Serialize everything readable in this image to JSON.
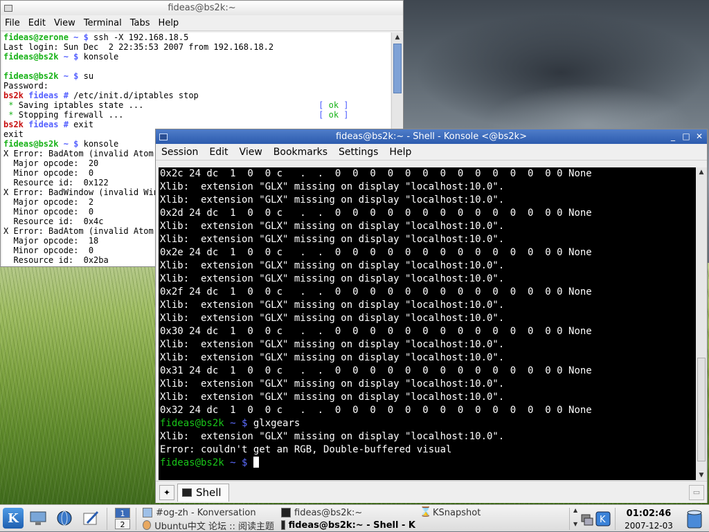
{
  "colors": {
    "active_titlebar": "#3a67b9",
    "terminal_bg": "#000000",
    "prompt_green": "#19c519",
    "prompt_blue": "#5c6cff",
    "root_red": "#c81010"
  },
  "back_window": {
    "title": "fideas@bs2k:~",
    "menu": [
      "File",
      "Edit",
      "View",
      "Terminal",
      "Tabs",
      "Help"
    ],
    "lines": [
      [
        {
          "t": "fideas@zerone",
          "c": "c-green"
        },
        {
          "t": " ~ $ ",
          "c": "c-blue"
        },
        {
          "t": "ssh -X 192.168.18.5"
        }
      ],
      [
        {
          "t": "Last login: Sun Dec  2 22:35:53 2007 from 192.168.18.2"
        }
      ],
      [
        {
          "t": "fideas@bs2k",
          "c": "c-green"
        },
        {
          "t": " ~ $ ",
          "c": "c-blue"
        },
        {
          "t": "konsole"
        }
      ],
      [
        {
          "t": ""
        }
      ],
      [
        {
          "t": "fideas@bs2k",
          "c": "c-green"
        },
        {
          "t": " ~ $ ",
          "c": "c-blue"
        },
        {
          "t": "su"
        }
      ],
      [
        {
          "t": "Password:"
        }
      ],
      [
        {
          "t": "bs2k ",
          "c": "c-red"
        },
        {
          "t": "fideas # ",
          "c": "c-blue"
        },
        {
          "t": "/etc/init.d/iptables stop"
        }
      ],
      [
        {
          "t": " * ",
          "c": "c-ok"
        },
        {
          "t": "Saving iptables state ...                                   "
        },
        {
          "t": "[ ",
          "c": "c-bracket"
        },
        {
          "t": "ok",
          "c": "c-ok"
        },
        {
          "t": " ]",
          "c": "c-bracket"
        }
      ],
      [
        {
          "t": " * ",
          "c": "c-ok"
        },
        {
          "t": "Stopping firewall ...                                       "
        },
        {
          "t": "[ ",
          "c": "c-bracket"
        },
        {
          "t": "ok",
          "c": "c-ok"
        },
        {
          "t": " ]",
          "c": "c-bracket"
        }
      ],
      [
        {
          "t": "bs2k ",
          "c": "c-red"
        },
        {
          "t": "fideas # ",
          "c": "c-blue"
        },
        {
          "t": "exit"
        }
      ],
      [
        {
          "t": "exit"
        }
      ],
      [
        {
          "t": "fideas@bs2k",
          "c": "c-green"
        },
        {
          "t": " ~ $ ",
          "c": "c-blue"
        },
        {
          "t": "konsole"
        }
      ],
      [
        {
          "t": "X Error: BadAtom (invalid Atom p"
        }
      ],
      [
        {
          "t": "  Major opcode:  20"
        }
      ],
      [
        {
          "t": "  Minor opcode:  0"
        }
      ],
      [
        {
          "t": "  Resource id:  0x122"
        }
      ],
      [
        {
          "t": "X Error: BadWindow (invalid Wind"
        }
      ],
      [
        {
          "t": "  Major opcode:  2"
        }
      ],
      [
        {
          "t": "  Minor opcode:  0"
        }
      ],
      [
        {
          "t": "  Resource id:  0x4c"
        }
      ],
      [
        {
          "t": "X Error: BadAtom (invalid Atom p"
        }
      ],
      [
        {
          "t": "  Major opcode:  18"
        }
      ],
      [
        {
          "t": "  Minor opcode:  0"
        }
      ],
      [
        {
          "t": "  Resource id:  0x2ba"
        }
      ]
    ]
  },
  "front_window": {
    "title": "fideas@bs2k:~ - Shell - Konsole <@bs2k>",
    "menu": [
      "Session",
      "Edit",
      "View",
      "Bookmarks",
      "Settings",
      "Help"
    ],
    "tab_label": "Shell",
    "lines": [
      [
        {
          "t": "0x2c 24 dc  1  0  0 c   .  .  0  0  0  0  0  0  0  0  0  0  0  0  0 0 None"
        }
      ],
      [
        {
          "t": "Xlib:  extension \"GLX\" missing on display \"localhost:10.0\"."
        }
      ],
      [
        {
          "t": "Xlib:  extension \"GLX\" missing on display \"localhost:10.0\"."
        }
      ],
      [
        {
          "t": "0x2d 24 dc  1  0  0 c   .  .  0  0  0  0  0  0  0  0  0  0  0  0  0 0 None"
        }
      ],
      [
        {
          "t": "Xlib:  extension \"GLX\" missing on display \"localhost:10.0\"."
        }
      ],
      [
        {
          "t": "Xlib:  extension \"GLX\" missing on display \"localhost:10.0\"."
        }
      ],
      [
        {
          "t": "0x2e 24 dc  1  0  0 c   .  .  0  0  0  0  0  0  0  0  0  0  0  0  0 0 None"
        }
      ],
      [
        {
          "t": "Xlib:  extension \"GLX\" missing on display \"localhost:10.0\"."
        }
      ],
      [
        {
          "t": "Xlib:  extension \"GLX\" missing on display \"localhost:10.0\"."
        }
      ],
      [
        {
          "t": "0x2f 24 dc  1  0  0 c   .  .  0  0  0  0  0  0  0  0  0  0  0  0  0 0 None"
        }
      ],
      [
        {
          "t": "Xlib:  extension \"GLX\" missing on display \"localhost:10.0\"."
        }
      ],
      [
        {
          "t": "Xlib:  extension \"GLX\" missing on display \"localhost:10.0\"."
        }
      ],
      [
        {
          "t": "0x30 24 dc  1  0  0 c   .  .  0  0  0  0  0  0  0  0  0  0  0  0  0 0 None"
        }
      ],
      [
        {
          "t": "Xlib:  extension \"GLX\" missing on display \"localhost:10.0\"."
        }
      ],
      [
        {
          "t": "Xlib:  extension \"GLX\" missing on display \"localhost:10.0\"."
        }
      ],
      [
        {
          "t": "0x31 24 dc  1  0  0 c   .  .  0  0  0  0  0  0  0  0  0  0  0  0  0 0 None"
        }
      ],
      [
        {
          "t": "Xlib:  extension \"GLX\" missing on display \"localhost:10.0\"."
        }
      ],
      [
        {
          "t": "Xlib:  extension \"GLX\" missing on display \"localhost:10.0\"."
        }
      ],
      [
        {
          "t": "0x32 24 dc  1  0  0 c   .  .  0  0  0  0  0  0  0  0  0  0  0  0  0 0 None"
        }
      ],
      [
        {
          "t": "fideas@bs2k ",
          "c": "t-green"
        },
        {
          "t": "~ $ ",
          "c": "t-blue"
        },
        {
          "t": "glxgears"
        }
      ],
      [
        {
          "t": "Xlib:  extension \"GLX\" missing on display \"localhost:10.0\"."
        }
      ],
      [
        {
          "t": "Error: couldn't get an RGB, Double-buffered visual"
        }
      ],
      [
        {
          "t": "fideas@bs2k ",
          "c": "t-green"
        },
        {
          "t": "~ $ ",
          "c": "t-blue"
        },
        {
          "t": "",
          "cursor": true
        }
      ]
    ]
  },
  "taskbar": {
    "pager": [
      "1",
      "2"
    ],
    "tasks": [
      {
        "label": "#og-zh - Konversation",
        "icon": "konversation-icon"
      },
      {
        "label": "Ubuntu中文 论坛 :: 阅读主题",
        "icon": "browser-icon"
      },
      {
        "label": "fideas@bs2k:~",
        "icon": "terminal-icon"
      },
      {
        "label": "fideas@bs2k:~ - Shell - K",
        "icon": "konsole-icon"
      },
      {
        "label": "KSnapshot",
        "icon": "ksnapshot-icon"
      }
    ],
    "clock_time": "01:02:46",
    "clock_date": "2007-12-03"
  }
}
